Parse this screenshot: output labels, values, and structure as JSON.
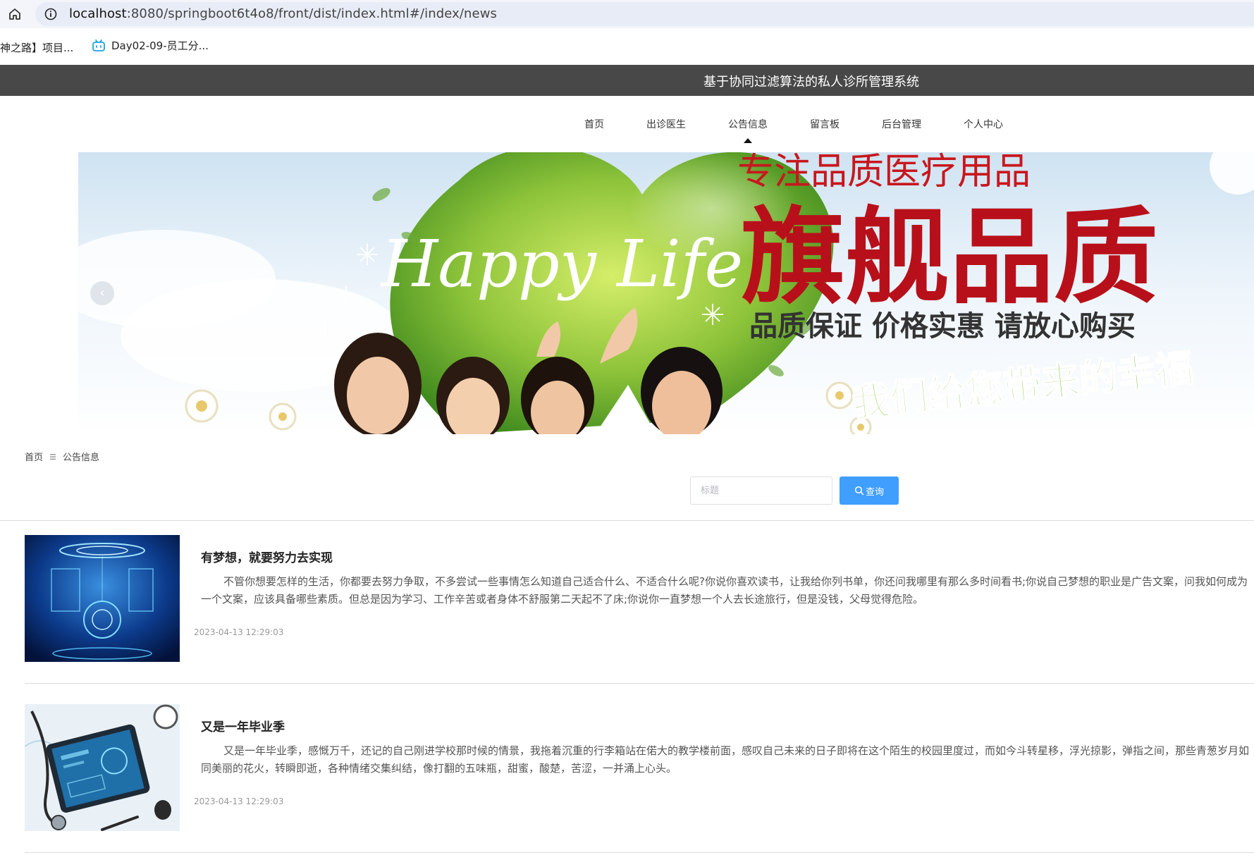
{
  "browser": {
    "url_host": "localhost",
    "url_rest": ":8080/springboot6t4o8/front/dist/index.html#/index/news",
    "bookmarks": [
      {
        "label": "神之路】项目...",
        "icon": "none"
      },
      {
        "label": "Day02-09-员工分...",
        "icon": "bilibili-tv-icon"
      }
    ]
  },
  "site": {
    "title": "基于协同过滤算法的私人诊所管理系统"
  },
  "nav": {
    "items": [
      {
        "label": "首页"
      },
      {
        "label": "出诊医生"
      },
      {
        "label": "公告信息"
      },
      {
        "label": "留言板"
      },
      {
        "label": "后台管理"
      },
      {
        "label": "个人中心"
      }
    ],
    "active_index": 2
  },
  "banner": {
    "script_text": "Happy Life",
    "top_line": "专注品质医疗用品",
    "headline": "旗舰品质",
    "subline": "品质保证  价格实惠  请放心购买",
    "bottom_text": "我们给您带来的幸福",
    "prev_arrow": "‹"
  },
  "breadcrumb": {
    "home": "首页",
    "separator_icon": "menu-lines-icon",
    "current": "公告信息"
  },
  "search": {
    "placeholder": "标题",
    "value": "",
    "button_label": "查询",
    "button_color": "#409eff"
  },
  "news": [
    {
      "title": "有梦想，就要努力去实现",
      "body": "不管你想要怎样的生活，你都要去努力争取，不多尝试一些事情怎么知道自己适合什么、不适合什么呢?你说你喜欢读书，让我给你列书单，你还问我哪里有那么多时间看书;你说自己梦想的职业是广告文案，问我如何成为一个文案，应该具备哪些素质。但总是因为学习、工作辛苦或者身体不舒服第二天起不了床;你说你一直梦想一个人去长途旅行，但是没钱，父母觉得危险。",
      "date": "2023-04-13 12:29:03",
      "thumb": "tech-hologram"
    },
    {
      "title": "又是一年毕业季",
      "body": "又是一年毕业季，感慨万千，还记的自己刚进学校那时候的情景，我拖着沉重的行李箱站在偌大的教学楼前面，感叹自己未来的日子即将在这个陌生的校园里度过，而如今斗转星移，浮光掠影，弹指之间，那些青葱岁月如同美丽的花火，转瞬即逝，各种情绪交集纠结，像打翻的五味瓶，甜蜜，酸楚，苦涩，一并涌上心头。",
      "date": "2023-04-13 12:29:03",
      "thumb": "medical-tablet"
    }
  ]
}
